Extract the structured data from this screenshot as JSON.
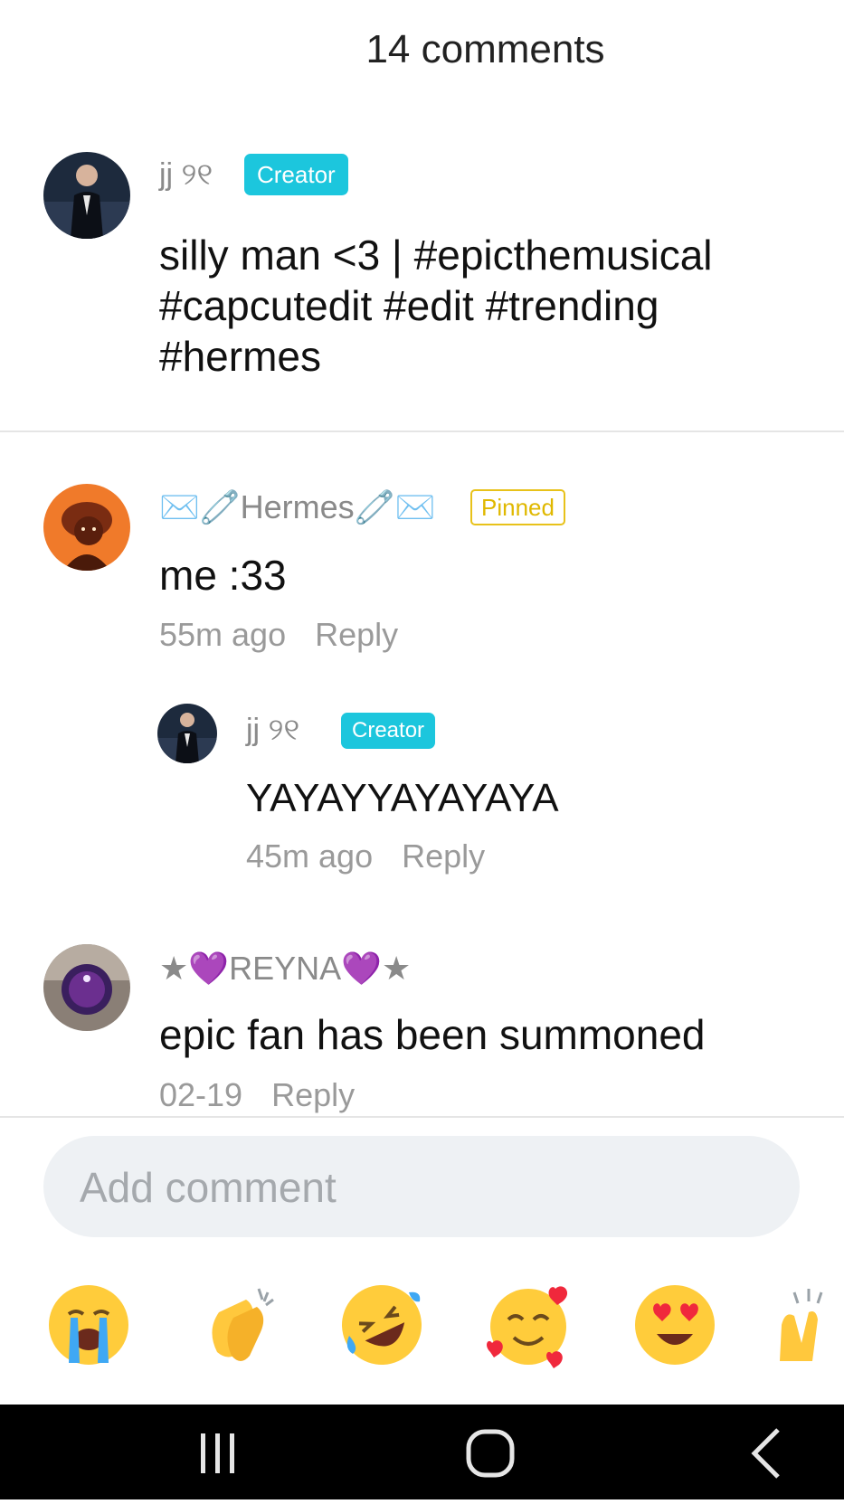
{
  "header": {
    "title": "14 comments"
  },
  "caption": {
    "username": "jj ୨୧",
    "badge": "Creator",
    "text": "silly man <3 | #epicthemusical #capcutedit #edit #trending #hermes"
  },
  "comments": [
    {
      "username": "✉️🧷Hermes🧷✉️",
      "badge": "Pinned",
      "text": "me :33",
      "time": "55m ago",
      "reply_label": "Reply"
    },
    {
      "username": "jj ୨୧",
      "badge": "Creator",
      "text": "YAYAYYAYAYAYA",
      "time": "45m ago",
      "reply_label": "Reply"
    },
    {
      "username": "★💜REYNA💜★",
      "text": "epic fan has been summoned",
      "time": "02-19",
      "reply_label": "Reply"
    }
  ],
  "composer": {
    "placeholder": "Add comment"
  },
  "emojis": [
    "😭",
    "👏",
    "🤣",
    "🥰",
    "😍",
    "🙌"
  ],
  "colors": {
    "creator_badge": "#1cc6dd",
    "pinned_badge": "#e0b800",
    "navbar": "#000000"
  },
  "icons": [
    "recent-apps-icon",
    "home-icon",
    "back-icon"
  ]
}
